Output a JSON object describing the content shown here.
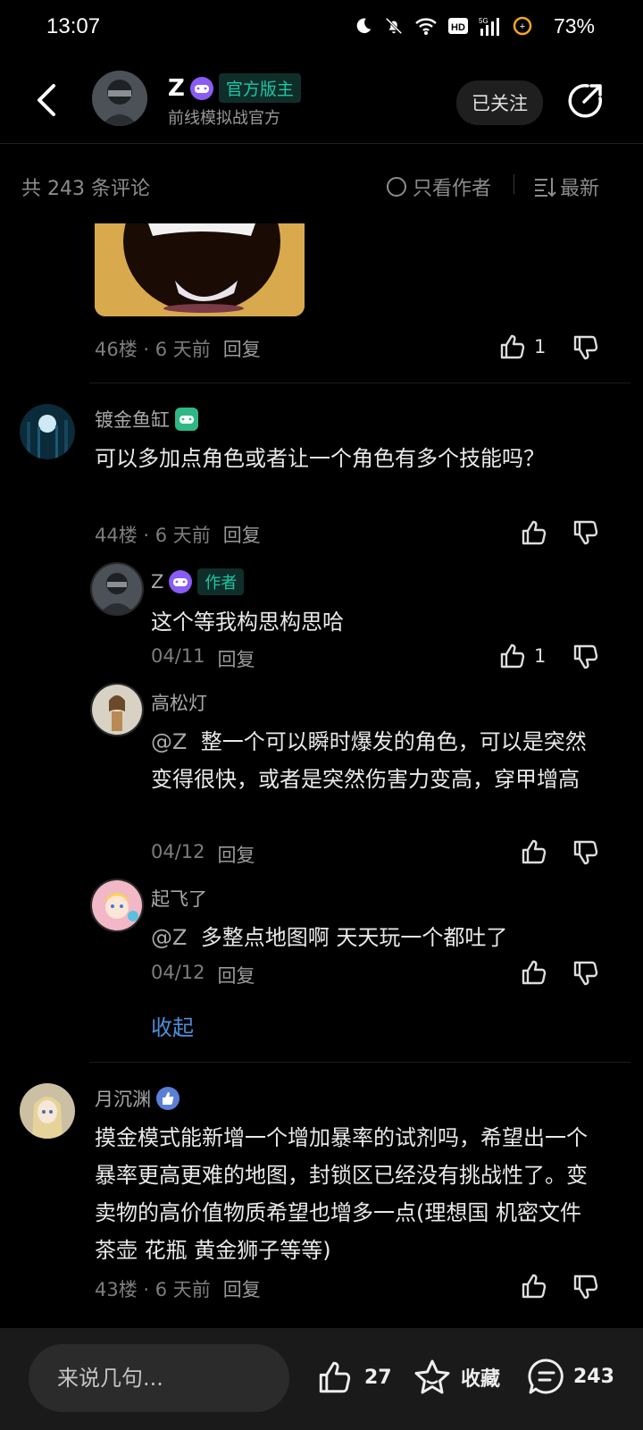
{
  "status_bar": {
    "time": "13:07",
    "battery": "73%"
  },
  "header": {
    "name": "Z",
    "badge": "官方版主",
    "subtitle": "前线模拟战官方",
    "follow_label": "已关注"
  },
  "filter": {
    "count_label": "共 243 条评论",
    "author_only": "只看作者",
    "sort": "最新"
  },
  "comments": [
    {
      "floor_meta": "46楼 · 6 天前",
      "reply_label": "回复",
      "likes": "1"
    },
    {
      "user": "镀金鱼缸",
      "text": "可以多加点角色或者让一个角色有多个技能吗？",
      "floor_meta": "44楼 · 6 天前",
      "reply_label": "回复",
      "replies": [
        {
          "user": "Z",
          "tag": "作者",
          "text": "这个等我构思构思哈",
          "date": "04/11",
          "reply_label": "回复",
          "likes": "1"
        },
        {
          "user": "高松灯",
          "mention": "@Z",
          "text": "整一个可以瞬时爆发的角色，可以是突然变得很快，或者是突然伤害力变高，穿甲增高",
          "date": "04/12",
          "reply_label": "回复"
        },
        {
          "user": "起飞了",
          "mention": "@Z",
          "text": "多整点地图啊 天天玩一个都吐了",
          "date": "04/12",
          "reply_label": "回复"
        }
      ],
      "collapse_label": "收起"
    },
    {
      "user": "月沉渊",
      "text": "摸金模式能新增一个增加暴率的试剂吗，希望出一个暴率更高更难的地图，封锁区已经没有挑战性了。变卖物的高价值物质希望也增多一点(理想国 机密文件 茶壶 花瓶 黄金狮子等等)",
      "floor_meta": "43楼 · 6 天前",
      "reply_label": "回复"
    }
  ],
  "bottom_bar": {
    "input_placeholder": "来说几句...",
    "likes": "27",
    "favorite_label": "收藏",
    "comments": "243"
  }
}
